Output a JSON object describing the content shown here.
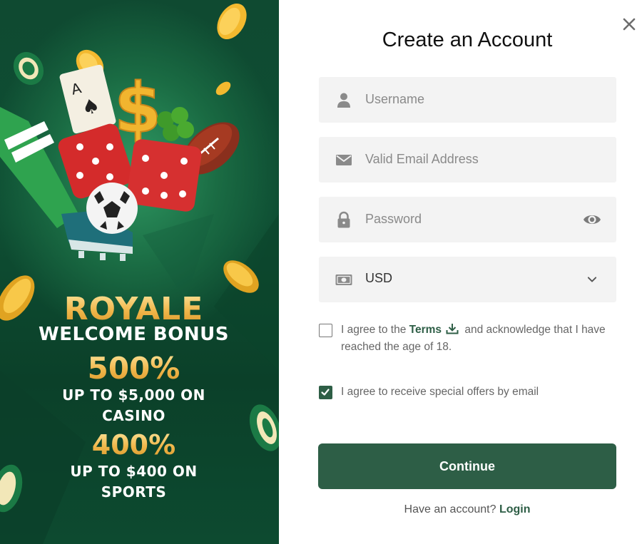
{
  "promo": {
    "line1": "ROYALE",
    "line2": "WELCOME BONUS",
    "line3": "500%",
    "line4": "UP TO $5,000 ON",
    "line5": "CASINO",
    "line6": "400%",
    "line7": "UP TO $400 ON",
    "line8": "SPORTS"
  },
  "form": {
    "title": "Create an Account",
    "username_placeholder": "Username",
    "email_placeholder": "Valid Email Address",
    "password_placeholder": "Password",
    "currency_value": "USD",
    "terms_prefix": "I agree to the ",
    "terms_link": "Terms",
    "terms_suffix": " and acknowledge that I have reached the age of 18.",
    "offers_label": "I agree to receive special offers by email",
    "continue_label": "Continue",
    "have_account": "Have an account? ",
    "login_label": "Login"
  },
  "state": {
    "terms_checked": false,
    "offers_checked": true
  },
  "icons": {
    "close": "close-icon",
    "username": "user-icon",
    "email": "envelope-icon",
    "password": "lock-icon",
    "show_password": "eye-icon",
    "currency": "banknote-icon",
    "dropdown": "chevron-down-icon",
    "terms_download": "download-icon",
    "checkbox": "checkmark-icon"
  },
  "colors": {
    "brand_green": "#2d5e46",
    "promo_bg": "#0f4a31",
    "gold": "#f0b64a",
    "field_bg": "#f3f3f3"
  }
}
